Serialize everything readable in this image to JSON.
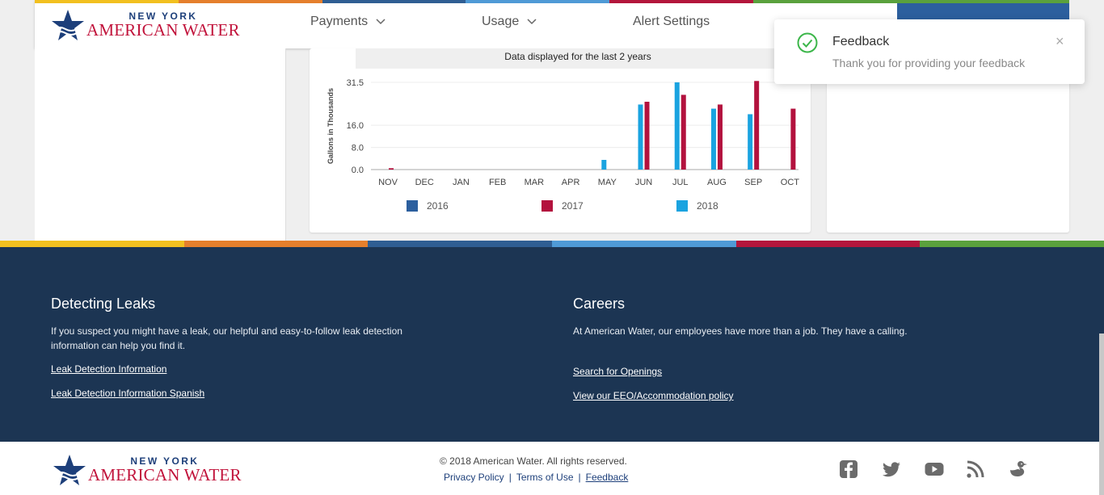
{
  "brand": {
    "line1": "NEW YORK",
    "line2": "AMERICAN WATER"
  },
  "stripe_colors": [
    "#f2c01f",
    "#e57f2c",
    "#2f5e93",
    "#4f9ad6",
    "#b3163c",
    "#5aa13d"
  ],
  "nav": [
    {
      "label": "Payments",
      "has_dropdown": true
    },
    {
      "label": "Usage",
      "has_dropdown": true
    },
    {
      "label": "Alert Settings",
      "has_dropdown": false
    }
  ],
  "chart_caption": "Data displayed for the last 2 years",
  "chart_data": {
    "type": "bar",
    "ylabel": "Gallons in Thousands",
    "yticks": [
      0.0,
      8.0,
      16.0,
      31.5
    ],
    "ytick_labels": [
      "0.0",
      "8.0",
      "16.0",
      "31.5"
    ],
    "ylim": [
      0,
      31.5
    ],
    "categories": [
      "NOV",
      "DEC",
      "JAN",
      "FEB",
      "MAR",
      "APR",
      "MAY",
      "JUN",
      "JUL",
      "AUG",
      "SEP",
      "OCT"
    ],
    "series": [
      {
        "name": "2016",
        "color": "#2c5f9e",
        "values": [
          0,
          0,
          0,
          0,
          0,
          0,
          0,
          0,
          0,
          0,
          0,
          0
        ]
      },
      {
        "name": "2017",
        "color": "#b3123e",
        "values": [
          0.5,
          0,
          0,
          0,
          0,
          0,
          0,
          24.5,
          27,
          23.5,
          32,
          22
        ]
      },
      {
        "name": "2018",
        "color": "#1aa3e0",
        "values": [
          0,
          0,
          0,
          0,
          0,
          0,
          3.5,
          23.5,
          31.5,
          22,
          20,
          0
        ]
      }
    ],
    "legend_position": "bottom"
  },
  "toast": {
    "title": "Feedback",
    "message": "Thank you for providing your feedback",
    "close": "×"
  },
  "footer": {
    "leaks": {
      "heading": "Detecting Leaks",
      "text_line1": "If you suspect you might have a leak, our helpful and easy-to-follow leak detection",
      "text_line2": "information can help you find it.",
      "link1": "Leak Detection Information",
      "link2": "Leak Detection Information Spanish"
    },
    "careers": {
      "heading": "Careers",
      "text": "At American Water, our employees have more than a job. They have a calling.",
      "link1": "Search for Openings",
      "link2": "View our EEO/Accommodation policy"
    }
  },
  "bottom": {
    "copyright": "© 2018 American Water. All rights reserved.",
    "privacy": "Privacy Policy",
    "sep": "|",
    "terms": "Terms of Use",
    "feedback": "Feedback",
    "social_icons": [
      "facebook-icon",
      "twitter-icon",
      "youtube-icon",
      "rss-icon",
      "duck-icon"
    ],
    "icon_color": "#6b6b6b"
  }
}
